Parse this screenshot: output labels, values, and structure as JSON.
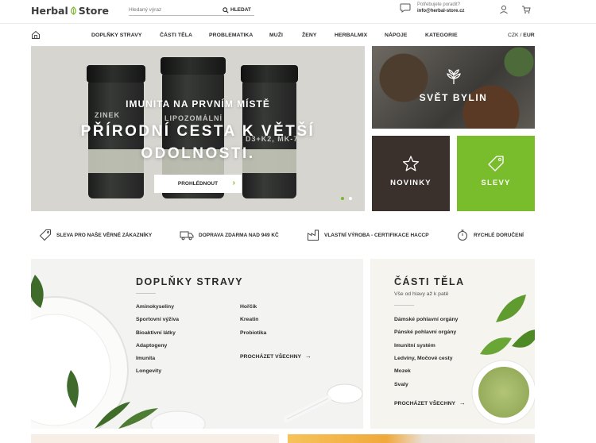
{
  "header": {
    "logo_left": "Herbal",
    "logo_right": "Store",
    "search_placeholder": "Hledaný výraz",
    "search_button": "HLEDAT",
    "contact_question": "Potřebujete poradit?",
    "contact_email": "info@herbal-store.cz"
  },
  "nav": {
    "items": [
      "DOPLŇKY STRAVY",
      "ČÁSTI TĚLA",
      "PROBLEMATIKA",
      "MUŽI",
      "ŽENY",
      "HERBALMIX",
      "NÁPOJE",
      "KATEGORIE"
    ],
    "currency_a": "CZK",
    "currency_sep": "/",
    "currency_b": "EUR"
  },
  "hero": {
    "jar_texts": [
      "ZINEK",
      "LIPOZOMÁLNÍ",
      "D3+K2, MK-7"
    ],
    "subtitle": "IMUNITA NA PRVNÍM MÍSTĚ",
    "title_line1": "PŘÍRODNÍ CESTA K VĚTŠÍ",
    "title_line2": "ODOLNOSTI.",
    "cta": "PROHLÉDNOUT",
    "slides": 2,
    "active_slide": 1
  },
  "tiles": {
    "herbs": "SVĚT BYLIN",
    "new": "NOVINKY",
    "sale": "SLEVY"
  },
  "benefits": [
    "SLEVA PRO NAŠE VĚRNÉ ZÁKAZNÍKY",
    "DOPRAVA ZDARMA NAD 949 KČ",
    "VLASTNÍ VÝROBA - CERTIFIKACE HACCP",
    "RYCHLÉ DORUČENÍ"
  ],
  "supplements": {
    "title": "DOPLŇKY STRAVY",
    "col1": [
      "Aminokyseliny",
      "Sportovní výživa",
      "Bioaktivní látky",
      "Adaptogeny",
      "Imunita",
      "Longevity"
    ],
    "col2": [
      "Hořčík",
      "Kreatin",
      "Probiotika"
    ],
    "more": "PROCHÁZET VŠECHNY"
  },
  "body_parts": {
    "title": "ČÁSTI TĚLA",
    "subtitle": "Vše od hlavy až k patě",
    "items": [
      "Dámské pohlavní orgány",
      "Pánské pohlavní orgány",
      "Imunitní systém",
      "Ledviny, Močové cesty",
      "Mozek",
      "Svaly"
    ],
    "more": "PROCHÁZET VŠECHNY"
  },
  "colors": {
    "accent_green": "#79bd2c",
    "dark_brown": "#3a302c",
    "panel_bg": "#f3f3f1"
  }
}
